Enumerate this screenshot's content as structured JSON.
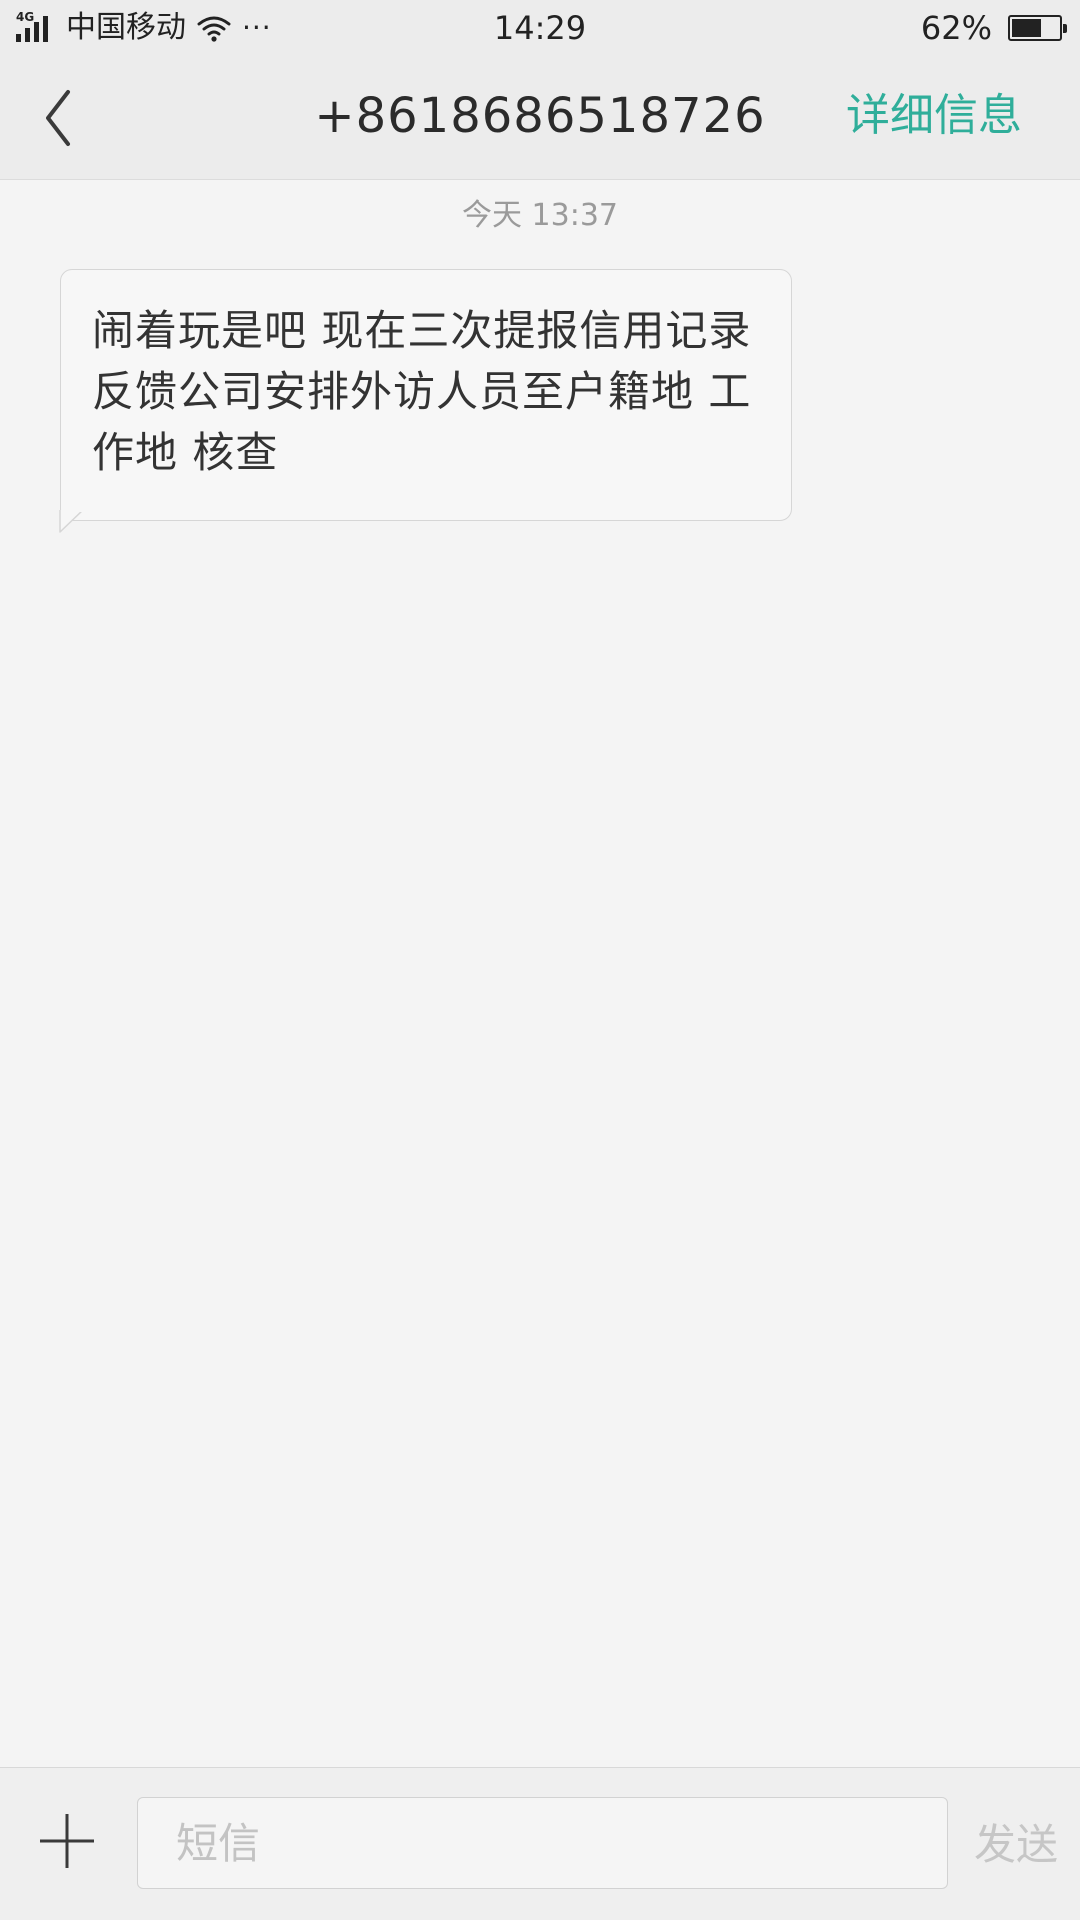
{
  "status_bar": {
    "network_type": "4G",
    "carrier": "中国移动",
    "more": "···",
    "time": "14:29",
    "battery_percent_label": "62%",
    "battery_level": 0.62
  },
  "header": {
    "title": "+8618686518726",
    "details_label": "详细信息"
  },
  "conversation": {
    "timestamp": "今天 13:37",
    "messages": [
      {
        "direction": "incoming",
        "text": "闹着玩是吧 现在三次提报信用记录 反馈公司安排外访人员至户籍地 工作地 核查"
      }
    ]
  },
  "input_bar": {
    "placeholder": "短信",
    "value": "",
    "send_label": "发送"
  },
  "colors": {
    "accent": "#2fae9a",
    "background": "#f4f4f4",
    "header_background": "#ececec",
    "send_disabled": "#c6c6c6"
  },
  "icons": {
    "back": "chevron-left-icon",
    "add": "plus-icon",
    "wifi": "wifi-icon",
    "signal": "signal-icon",
    "battery": "battery-icon"
  }
}
